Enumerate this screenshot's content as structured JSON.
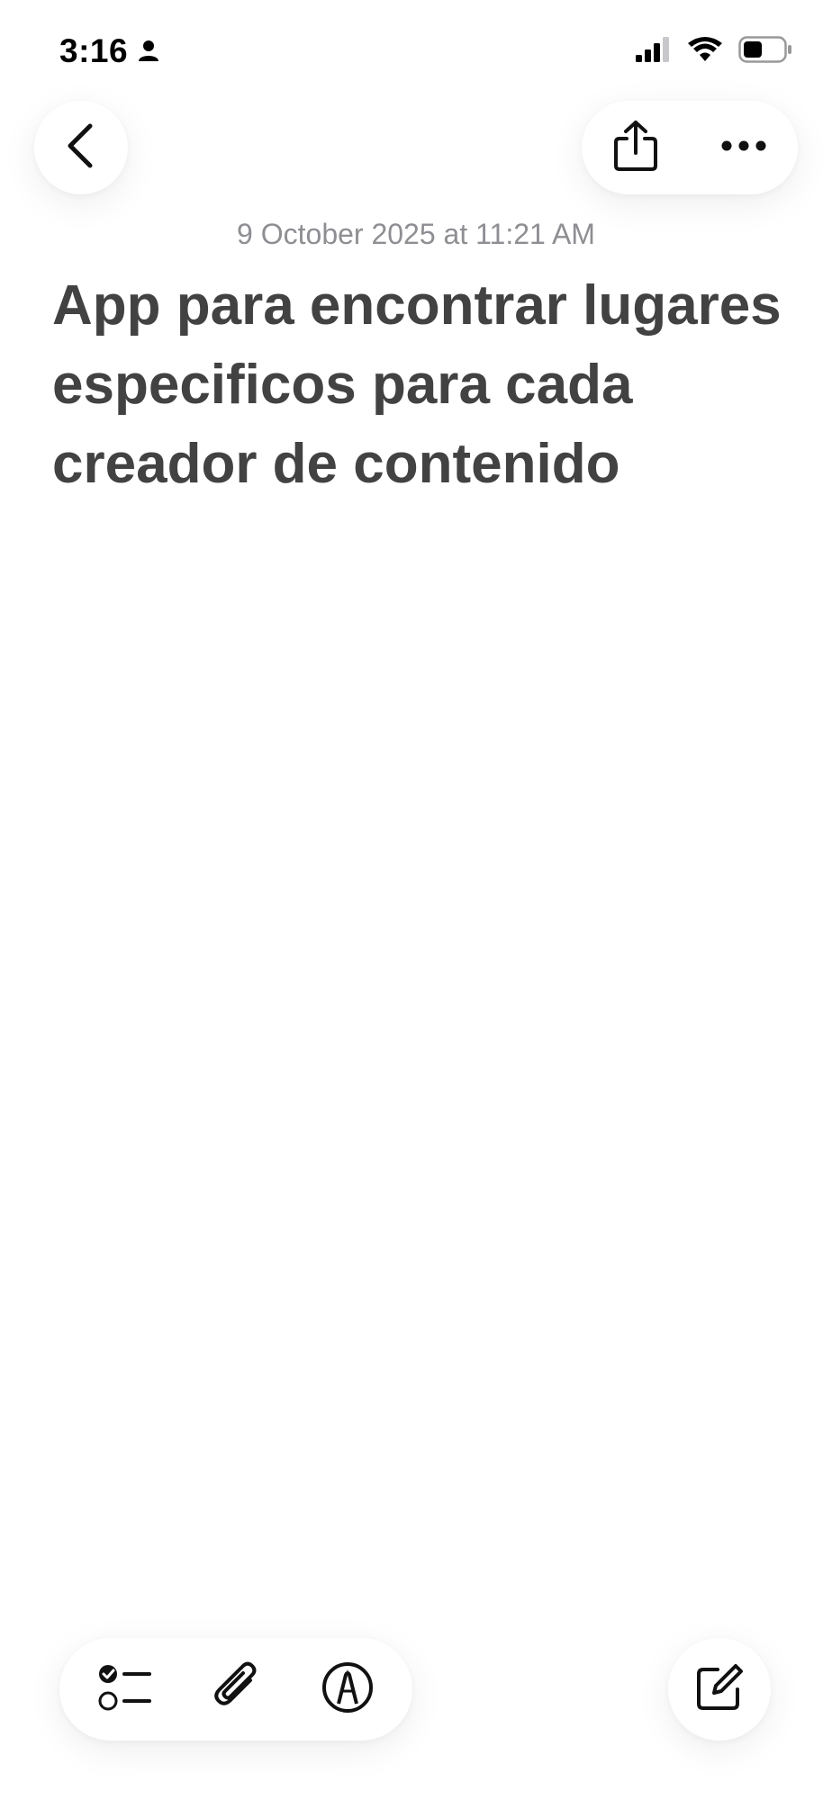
{
  "status_bar": {
    "time": "3:16",
    "icons": [
      "person-icon",
      "cellular-signal-icon",
      "wifi-icon",
      "battery-icon"
    ]
  },
  "toolbar_top": {
    "icons": [
      "chevron-left-icon",
      "share-icon",
      "more-icon"
    ]
  },
  "note": {
    "date": "9 October 2025 at 11:21 AM",
    "title": "App para encontrar lugares especificos para cada creador de contenido"
  },
  "toolbar_bottom": {
    "icons": [
      "checklist-icon",
      "paperclip-icon",
      "markup-pen-icon",
      "compose-icon"
    ]
  }
}
